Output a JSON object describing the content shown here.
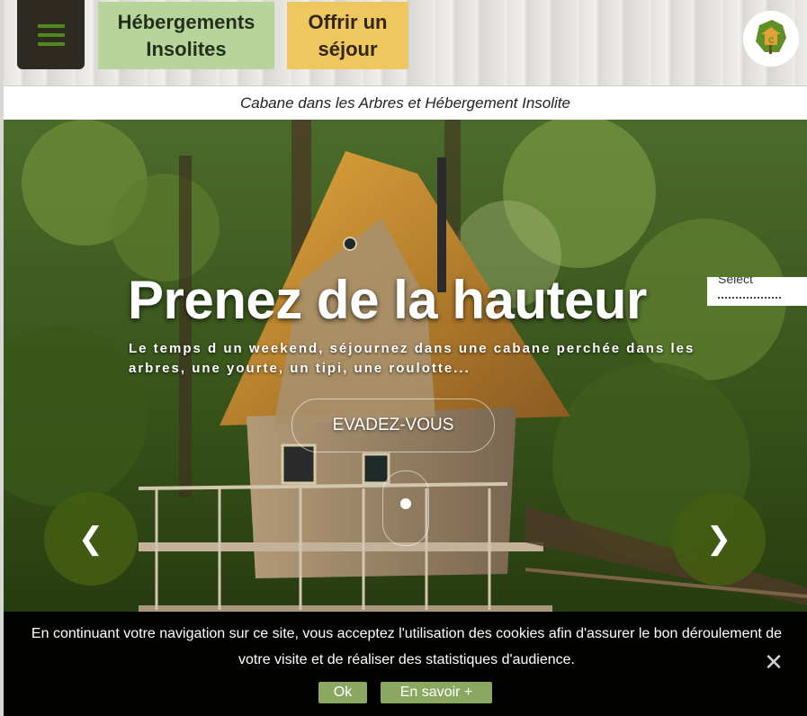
{
  "colors": {
    "menu_bg": "#2e2a21",
    "menu_icon": "#4f8a1d",
    "nav_green": "#b7d49b",
    "nav_yellow": "#efc75f",
    "arrow_bg": "#445c12",
    "cookie_button": "#8aa862"
  },
  "header": {
    "menu_icon": "hamburger-icon",
    "nav": {
      "hebergements_label": "Hébergements\nInsolites",
      "offrir_label": "Offrir un\nséjour"
    },
    "logo_icon": "france-treehouse-logo"
  },
  "tagline": "Cabane dans les Arbres et Hébergement Insolite",
  "hero": {
    "title": "Prenez de la hauteur",
    "subtitle": "Le temps d un weekend, séjournez dans une cabane perchée dans les arbres, une yourte, un tipi, une roulotte...",
    "cta_label": "EVADEZ-VOUS",
    "prev_icon": "chevron-left-icon",
    "next_icon": "chevron-right-icon",
    "prev_glyph": "❮",
    "next_glyph": "❯",
    "language_select": "Select"
  },
  "cookie_banner": {
    "text": "En continuant votre navigation sur ce site, vous acceptez l'utilisation des cookies afin d'assurer le bon déroulement de votre visite et de réaliser des statistiques d'audience.",
    "close_glyph": "✕",
    "ok_label": "Ok",
    "more_label": "En savoir +"
  }
}
